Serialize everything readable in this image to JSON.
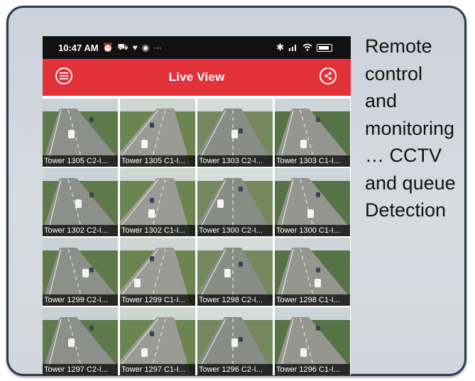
{
  "status_bar": {
    "time": "10:47 AM",
    "icons": [
      "alarm-icon",
      "car-icon",
      "heart-icon",
      "record-icon",
      "more-icon"
    ],
    "right_icons": [
      "bluetooth-icon",
      "signal-icon",
      "wifi-icon",
      "battery-icon"
    ]
  },
  "app_bar": {
    "title": "Live View",
    "left_icon": "menu-icon",
    "right_icon": "share-icon",
    "color": "#e3313a"
  },
  "cameras": [
    {
      "label": "Tower 1305 C2-I..."
    },
    {
      "label": "Tower 1305 C1-I..."
    },
    {
      "label": "Tower 1303 C2-I..."
    },
    {
      "label": "Tower 1303 C1-I..."
    },
    {
      "label": "Tower 1302 C2-I..."
    },
    {
      "label": "Tower 1302 C1-I..."
    },
    {
      "label": "Tower 1300 C2-I..."
    },
    {
      "label": "Tower 1300 C1-I..."
    },
    {
      "label": "Tower 1299 C2-I..."
    },
    {
      "label": "Tower 1299 C1-I..."
    },
    {
      "label": "Tower 1298 C2-I..."
    },
    {
      "label": "Tower 1298 C1-I..."
    },
    {
      "label": "Tower 1297 C2-I..."
    },
    {
      "label": "Tower 1297 C1-I..."
    },
    {
      "label": "Tower 1296 C2-I..."
    },
    {
      "label": "Tower 1296 C1-I..."
    }
  ],
  "caption": {
    "lines": [
      "Remote",
      "control",
      "and",
      "monitoring",
      "… CCTV",
      "and queue",
      "Detection"
    ]
  },
  "colors": {
    "panel_border": "#2b3950",
    "panel_fill": "#d2d6dd",
    "app_bar": "#e3313a",
    "status_bar": "#111111"
  }
}
